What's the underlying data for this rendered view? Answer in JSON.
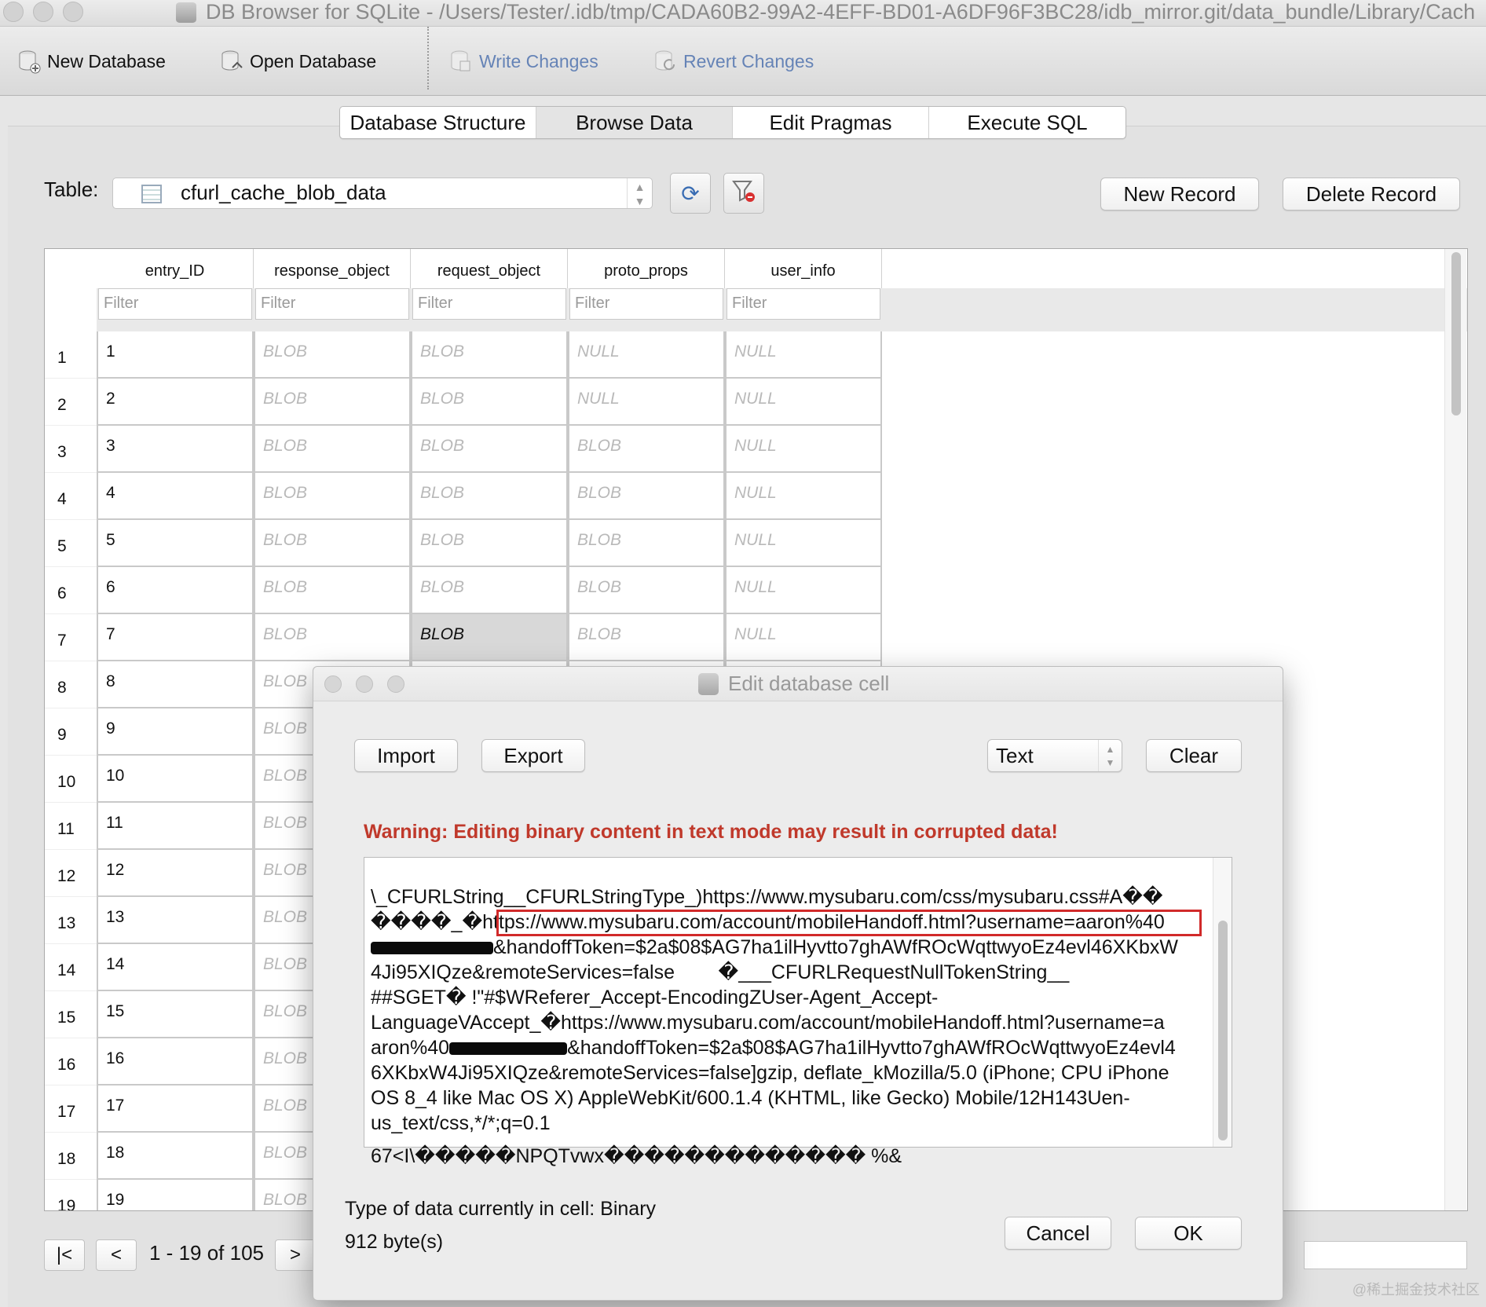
{
  "window": {
    "title": "DB Browser for SQLite - /Users/Tester/.idb/tmp/CADA60B2-99A2-4EFF-BD01-A6DF96F3BC28/idb_mirror.git/data_bundle/Library/Cach"
  },
  "toolbar": {
    "new_db": "New Database",
    "open_db": "Open Database",
    "write": "Write Changes",
    "revert": "Revert Changes"
  },
  "tabs": [
    "Database Structure",
    "Browse Data",
    "Edit Pragmas",
    "Execute SQL"
  ],
  "active_tab": "Browse Data",
  "browse": {
    "table_label": "Table:",
    "table_name": "cfurl_cache_blob_data",
    "new_record": "New Record",
    "delete_record": "Delete Record",
    "columns": [
      "entry_ID",
      "response_object",
      "request_object",
      "proto_props",
      "user_info"
    ],
    "filter_placeholder": "Filter",
    "rows": [
      [
        "1",
        "1",
        "BLOB",
        "BLOB",
        "NULL",
        "NULL"
      ],
      [
        "2",
        "2",
        "BLOB",
        "BLOB",
        "NULL",
        "NULL"
      ],
      [
        "3",
        "3",
        "BLOB",
        "BLOB",
        "BLOB",
        "NULL"
      ],
      [
        "4",
        "4",
        "BLOB",
        "BLOB",
        "BLOB",
        "NULL"
      ],
      [
        "5",
        "5",
        "BLOB",
        "BLOB",
        "BLOB",
        "NULL"
      ],
      [
        "6",
        "6",
        "BLOB",
        "BLOB",
        "BLOB",
        "NULL"
      ],
      [
        "7",
        "7",
        "BLOB",
        "BLOB",
        "BLOB",
        "NULL"
      ],
      [
        "8",
        "8",
        "BLOB",
        "",
        "",
        ""
      ],
      [
        "9",
        "9",
        "BLOB",
        "",
        "",
        ""
      ],
      [
        "10",
        "10",
        "BLOB",
        "",
        "",
        ""
      ],
      [
        "11",
        "11",
        "BLOB",
        "",
        "",
        ""
      ],
      [
        "12",
        "12",
        "BLOB",
        "",
        "",
        ""
      ],
      [
        "13",
        "13",
        "BLOB",
        "",
        "",
        ""
      ],
      [
        "14",
        "14",
        "BLOB",
        "",
        "",
        ""
      ],
      [
        "15",
        "15",
        "BLOB",
        "",
        "",
        ""
      ],
      [
        "16",
        "16",
        "BLOB",
        "",
        "",
        ""
      ],
      [
        "17",
        "17",
        "BLOB",
        "",
        "",
        ""
      ],
      [
        "18",
        "18",
        "BLOB",
        "",
        "",
        ""
      ],
      [
        "19",
        "19",
        "BLOB",
        "",
        "",
        ""
      ]
    ],
    "selected_row": 7,
    "selected_col": 3,
    "pager": {
      "first": "|<",
      "prev": "<",
      "range": "1 - 19 of 105",
      "next": ">"
    }
  },
  "dialog": {
    "title": "Edit database cell",
    "import": "Import",
    "export": "Export",
    "mode": "Text",
    "clear": "Clear",
    "warning": "Warning: Editing binary content in text mode may result in corrupted data!",
    "content_lines": [
      "\\_CFURLString__CFURLStringType_)https://www.mysubaru.com/css/mysubaru.css#A��",
      "����_�https://www.mysubaru.com/account/mobileHandoff.html?username=aaron%40",
      "&handoffToken=$2a$08$AG7ha1ilHyvtto7ghAWfROcWqttwyoEz4evl46XKbxW",
      "4Ji95XIQze&remoteServices=false        �___CFURLRequestNullTokenString__",
      "##SGET� !\"#$WReferer_Accept-EncodingZUser-Agent_Accept-",
      "LanguageVAccept_�https://www.mysubaru.com/account/mobileHandoff.html?username=a",
      "aron%40",
      "&handoffToken=$2a$08$AG7ha1ilHyvtto7ghAWfROcWqttwyoEz4evl4",
      "6XKbxW4Ji95XIQze&remoteServices=false]gzip, deflate_kMozilla/5.0 (iPhone; CPU iPhone",
      "OS 8_4 like Mac OS X) AppleWebKit/600.1.4 (KHTML, like Gecko) Mobile/12H143Uen-",
      "us_text/css,*/*;q=0.1",
      "67<I\\�����NPQTvwx������������� %&"
    ],
    "type_info": "Type of data currently in cell: Binary",
    "size_info": "912 byte(s)",
    "cancel": "Cancel",
    "ok": "OK"
  },
  "watermark": "@稀土掘金技术社区",
  "colors": {
    "warning": "#c0392b",
    "highlight_box": "#d12a2a",
    "blob_text": "#b9b9b9"
  }
}
